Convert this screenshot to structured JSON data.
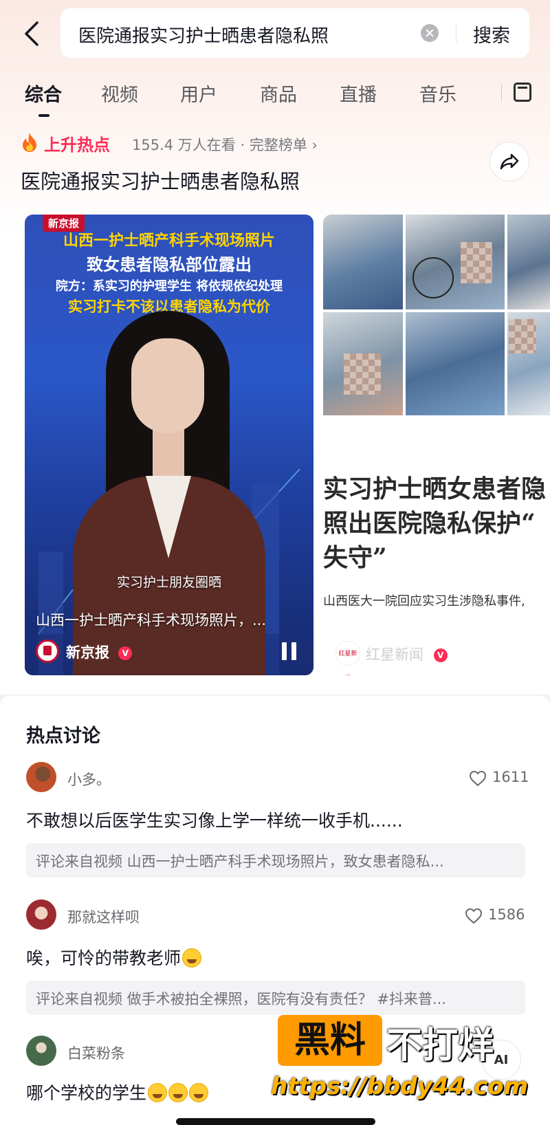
{
  "header": {
    "search_query": "医院通报实习护士晒患者隐私照",
    "search_button": "搜索"
  },
  "tabs": [
    "综合",
    "视频",
    "用户",
    "商品",
    "直播",
    "音乐"
  ],
  "hot": {
    "label": "上升热点",
    "watching": "155.4 万人在看 · 完整榜单 ›",
    "title": "医院通报实习护士晒患者隐私照"
  },
  "video1": {
    "source_badge": "新京报",
    "headline_line1": "山西一护士晒产科手术现场照片",
    "headline_line2": "致女患者隐私部位露出",
    "headline_line3": "院方：系实习的护理学生 将依规依纪处理",
    "headline_line4": "实习打卡不该以患者隐私为代价",
    "subtitle": "实习护士朋友圈晒",
    "caption": "山西一护士晒产科手术现场照片，...",
    "author": "新京报",
    "verified_mark": "V"
  },
  "video2": {
    "headline_line1": "实习护士晒女患者隐",
    "headline_line2": "照出医院隐私保护“",
    "headline_line3": "失守”",
    "body_line": "山西医大一院回应实习生涉隐私事件,",
    "author": "红星新闻",
    "logo_text": "红星新闻",
    "verified_mark": "V"
  },
  "discussion": {
    "title": "热点讨论",
    "comments": [
      {
        "user": "小多。",
        "likes": "1611",
        "text": "不敢想以后医学生实习像上学一样统一收手机......",
        "source": "评论来自视频 山西一护士晒产科手术现场照片，致女患者隐私..."
      },
      {
        "user": "那就这样呗",
        "likes": "1586",
        "text": "唉，可怜的带教老师",
        "source": "评论来自视频 做手术被拍全裸照，医院有没有责任？ #抖来普..."
      },
      {
        "user": "白菜粉条",
        "text": "哪个学校的学生"
      }
    ],
    "ai_button": "AI"
  },
  "watermark": {
    "box_text": "黑料",
    "text": "不打烊",
    "url": "https://bbdy44.com"
  },
  "colors": {
    "accent": "#fe2c55",
    "watermark_orange": "#ff9a00",
    "news_blue": "#2a57c8"
  }
}
